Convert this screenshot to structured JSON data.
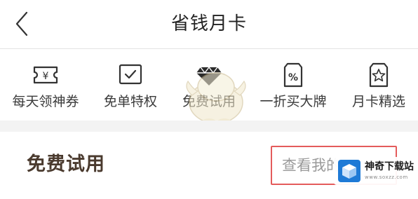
{
  "header": {
    "title": "省钱月卡",
    "back_icon": "chevron-left-icon"
  },
  "tabs": [
    {
      "label": "每天领神券",
      "icon": "coupon-yen-icon",
      "active": false
    },
    {
      "label": "免单特权",
      "icon": "check-box-icon",
      "active": false
    },
    {
      "label": "免费试用",
      "icon": "diamond-gem-icon",
      "active": true
    },
    {
      "label": "一折买大牌",
      "icon": "percent-tag-icon",
      "active": false
    },
    {
      "label": "月卡精选",
      "icon": "star-tag-icon",
      "active": false
    }
  ],
  "section": {
    "title": "免费试用",
    "link_label": "查看我的"
  },
  "watermark": {
    "title": "神奇下载站",
    "url": "www.soxzz.com"
  },
  "colors": {
    "accent_border": "#e45b5b",
    "section_title": "#4a3a2e",
    "badge_blue": "#1e7ad6"
  }
}
